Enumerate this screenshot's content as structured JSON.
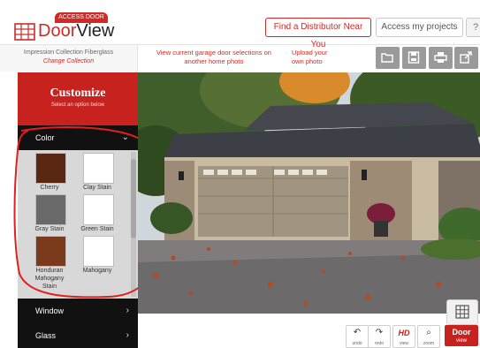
{
  "brand": {
    "arch_text": "ACCESS DOOR",
    "name_part1": "Door",
    "name_part2": "View"
  },
  "header": {
    "distributor_btn": "Find a Distributor Near You",
    "projects_btn": "Access my projects",
    "help_btn": "?"
  },
  "subheader": {
    "collection": "Impression Collection Fiberglass",
    "change_collection": "Change Collection",
    "view_current": "View current garage door selections on another home photo",
    "upload_photo": "Upload your own photo"
  },
  "customize": {
    "title": "Customize",
    "subtitle": "Select an option below"
  },
  "accordion": [
    {
      "label": "Color",
      "chevron": "⌄"
    },
    {
      "label": "Window",
      "chevron": "›"
    },
    {
      "label": "Glass",
      "chevron": "›"
    }
  ],
  "colors": [
    {
      "name": "Cherry",
      "hex": "#5a2712"
    },
    {
      "name": "Clay Stain",
      "hex": "#ffffff"
    },
    {
      "name": "Gray Stain",
      "hex": "#6a6a6a"
    },
    {
      "name": "Green Stain",
      "hex": "#ffffff"
    },
    {
      "name": "Honduran Mahogany Stain",
      "hex": "#7b3a1c"
    },
    {
      "name": "Mahogany",
      "hex": "#ffffff"
    }
  ],
  "bottom_tools": [
    {
      "label": "undo",
      "icon": "↶"
    },
    {
      "label": "redo",
      "icon": "↷"
    },
    {
      "label": "view",
      "icon": "HD"
    },
    {
      "label": "zoom",
      "icon": "⌕"
    }
  ],
  "door_view": {
    "title": "Door",
    "sub": "view"
  },
  "accent": "#c8221f"
}
